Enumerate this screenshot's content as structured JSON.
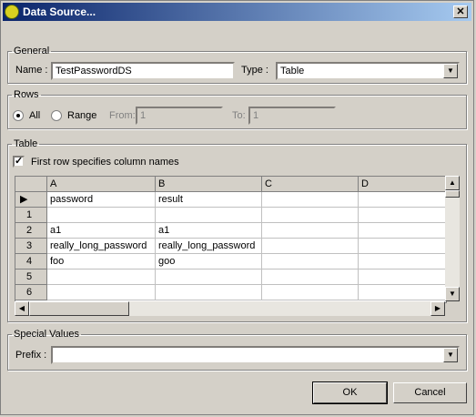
{
  "window": {
    "title": "Data Source..."
  },
  "general": {
    "legend": "General",
    "name_label": "Name :",
    "name_value": "TestPasswordDS",
    "type_label": "Type :",
    "type_value": "Table"
  },
  "rows": {
    "legend": "Rows",
    "all_label": "All",
    "range_label": "Range",
    "from_label": "From:",
    "from_value": "1",
    "to_label": "To:",
    "to_value": "1",
    "selected": "All"
  },
  "table": {
    "legend": "Table",
    "first_row_label": "First row specifies column names",
    "first_row_checked": true,
    "columns": [
      "A",
      "B",
      "C",
      "D"
    ],
    "row_headers": [
      "",
      "1",
      "2",
      "3",
      "4",
      "5",
      "6"
    ],
    "cells": [
      [
        "password",
        "result",
        "",
        ""
      ],
      [
        "",
        "",
        "",
        ""
      ],
      [
        "a1",
        "a1",
        "",
        ""
      ],
      [
        "really_long_password",
        "really_long_password",
        "",
        ""
      ],
      [
        "foo",
        "goo",
        "",
        ""
      ],
      [
        "",
        "",
        "",
        ""
      ],
      [
        "",
        "",
        "",
        ""
      ]
    ]
  },
  "special": {
    "legend": "Special Values",
    "prefix_label": "Prefix :",
    "prefix_value": ""
  },
  "buttons": {
    "ok": "OK",
    "cancel": "Cancel"
  },
  "icons": {
    "app": "app-icon",
    "close": "close-icon",
    "dropdown": "chevron-down-icon"
  }
}
